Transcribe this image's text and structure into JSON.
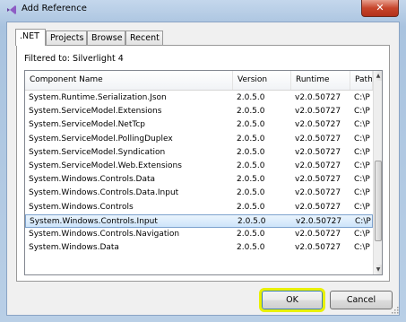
{
  "window": {
    "title": "Add Reference",
    "close_symbol": "✕"
  },
  "tabs": [
    ".NET",
    "Projects",
    "Browse",
    "Recent"
  ],
  "filter_text": "Filtered to: Silverlight 4",
  "columns": [
    "Component Name",
    "Version",
    "Runtime",
    "Path"
  ],
  "rows": [
    {
      "name": "System.Runtime.Serialization.Json",
      "version": "2.0.5.0",
      "runtime": "v2.0.50727",
      "path": "C:\\P"
    },
    {
      "name": "System.ServiceModel.Extensions",
      "version": "2.0.5.0",
      "runtime": "v2.0.50727",
      "path": "C:\\P"
    },
    {
      "name": "System.ServiceModel.NetTcp",
      "version": "2.0.5.0",
      "runtime": "v2.0.50727",
      "path": "C:\\P"
    },
    {
      "name": "System.ServiceModel.PollingDuplex",
      "version": "2.0.5.0",
      "runtime": "v2.0.50727",
      "path": "C:\\P"
    },
    {
      "name": "System.ServiceModel.Syndication",
      "version": "2.0.5.0",
      "runtime": "v2.0.50727",
      "path": "C:\\P"
    },
    {
      "name": "System.ServiceModel.Web.Extensions",
      "version": "2.0.5.0",
      "runtime": "v2.0.50727",
      "path": "C:\\P"
    },
    {
      "name": "System.Windows.Controls.Data",
      "version": "2.0.5.0",
      "runtime": "v2.0.50727",
      "path": "C:\\P"
    },
    {
      "name": "System.Windows.Controls.Data.Input",
      "version": "2.0.5.0",
      "runtime": "v2.0.50727",
      "path": "C:\\P"
    },
    {
      "name": "System.Windows.Controls",
      "version": "2.0.5.0",
      "runtime": "v2.0.50727",
      "path": "C:\\P"
    },
    {
      "name": "System.Windows.Controls.Input",
      "version": "2.0.5.0",
      "runtime": "v2.0.50727",
      "path": "C:\\P",
      "selected": true
    },
    {
      "name": "System.Windows.Controls.Navigation",
      "version": "2.0.5.0",
      "runtime": "v2.0.50727",
      "path": "C:\\P"
    },
    {
      "name": "System.Windows.Data",
      "version": "2.0.5.0",
      "runtime": "v2.0.50727",
      "path": "C:\\P"
    }
  ],
  "buttons": {
    "ok": "OK",
    "cancel": "Cancel"
  },
  "colors": {
    "ok_highlight": "#e8f000",
    "selection": "#cde4fa"
  }
}
